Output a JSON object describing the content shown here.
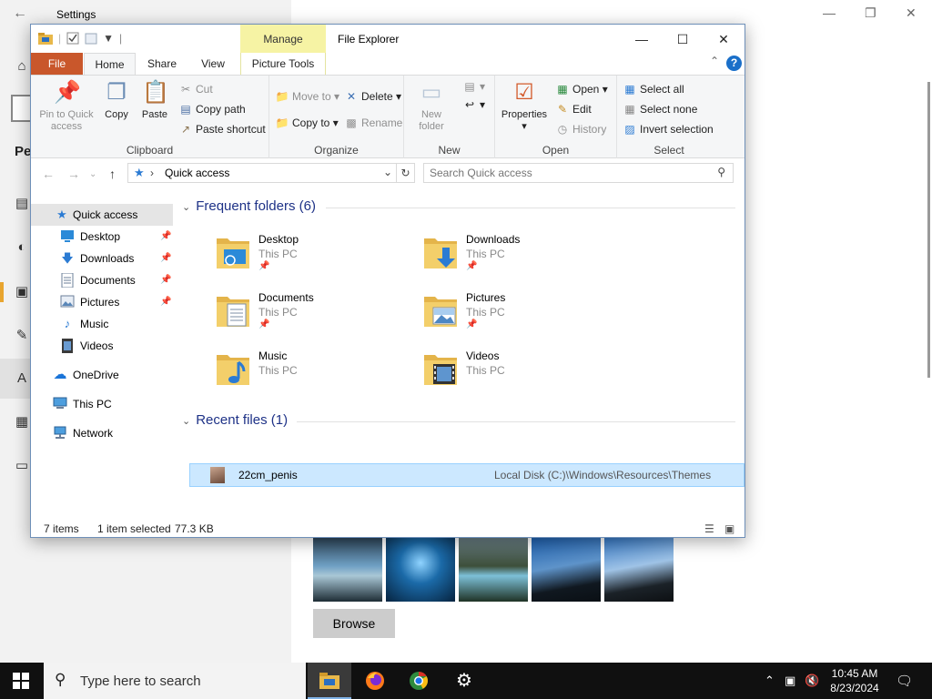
{
  "settings": {
    "title": "Settings",
    "heading_fragment": "Per",
    "browse_label": "Browse"
  },
  "explorer": {
    "title": "File Explorer",
    "manage_tab": "Manage",
    "tabs": {
      "file": "File",
      "home": "Home",
      "share": "Share",
      "view": "View",
      "picture_tools": "Picture Tools"
    },
    "ribbon": {
      "clipboard": {
        "label": "Clipboard",
        "pin": "Pin to Quick access",
        "copy": "Copy",
        "paste": "Paste",
        "cut": "Cut",
        "copy_path": "Copy path",
        "paste_shortcut": "Paste shortcut"
      },
      "organize": {
        "label": "Organize",
        "move_to": "Move to",
        "copy_to": "Copy to",
        "delete": "Delete",
        "rename": "Rename"
      },
      "new": {
        "label": "New",
        "new_folder": "New folder"
      },
      "open": {
        "label": "Open",
        "properties": "Properties",
        "open": "Open",
        "edit": "Edit",
        "history": "History"
      },
      "select": {
        "label": "Select",
        "select_all": "Select all",
        "select_none": "Select none",
        "invert": "Invert selection"
      }
    },
    "address": {
      "location": "Quick access",
      "search_placeholder": "Search Quick access"
    },
    "nav": [
      {
        "label": "Quick access",
        "icon": "star-icon"
      },
      {
        "label": "Desktop",
        "icon": "desktop-icon",
        "pinned": true
      },
      {
        "label": "Downloads",
        "icon": "download-icon",
        "pinned": true
      },
      {
        "label": "Documents",
        "icon": "document-icon",
        "pinned": true
      },
      {
        "label": "Pictures",
        "icon": "picture-icon",
        "pinned": true
      },
      {
        "label": "Music",
        "icon": "music-icon"
      },
      {
        "label": "Videos",
        "icon": "video-icon"
      },
      {
        "label": "OneDrive",
        "icon": "cloud-icon"
      },
      {
        "label": "This PC",
        "icon": "computer-icon"
      },
      {
        "label": "Network",
        "icon": "network-icon"
      }
    ],
    "frequent_header": "Frequent folders (6)",
    "frequent": [
      {
        "name": "Desktop",
        "loc": "This PC"
      },
      {
        "name": "Downloads",
        "loc": "This PC"
      },
      {
        "name": "Documents",
        "loc": "This PC"
      },
      {
        "name": "Pictures",
        "loc": "This PC"
      },
      {
        "name": "Music",
        "loc": "This PC"
      },
      {
        "name": "Videos",
        "loc": "This PC"
      }
    ],
    "recent_header": "Recent files (1)",
    "recent": [
      {
        "name": "22cm_penis",
        "path": "Local Disk (C:)\\Windows\\Resources\\Themes"
      }
    ],
    "status": {
      "items": "7 items",
      "selected": "1 item selected",
      "size": "77.3 KB"
    }
  },
  "taskbar": {
    "search_placeholder": "Type here to search",
    "time": "10:45 AM",
    "date": "8/23/2024"
  },
  "colors": {
    "file_tab": "#c9572b",
    "manage_tab": "#f6f3a4",
    "selection": "#cce8ff",
    "header_blue": "#1e3287"
  }
}
